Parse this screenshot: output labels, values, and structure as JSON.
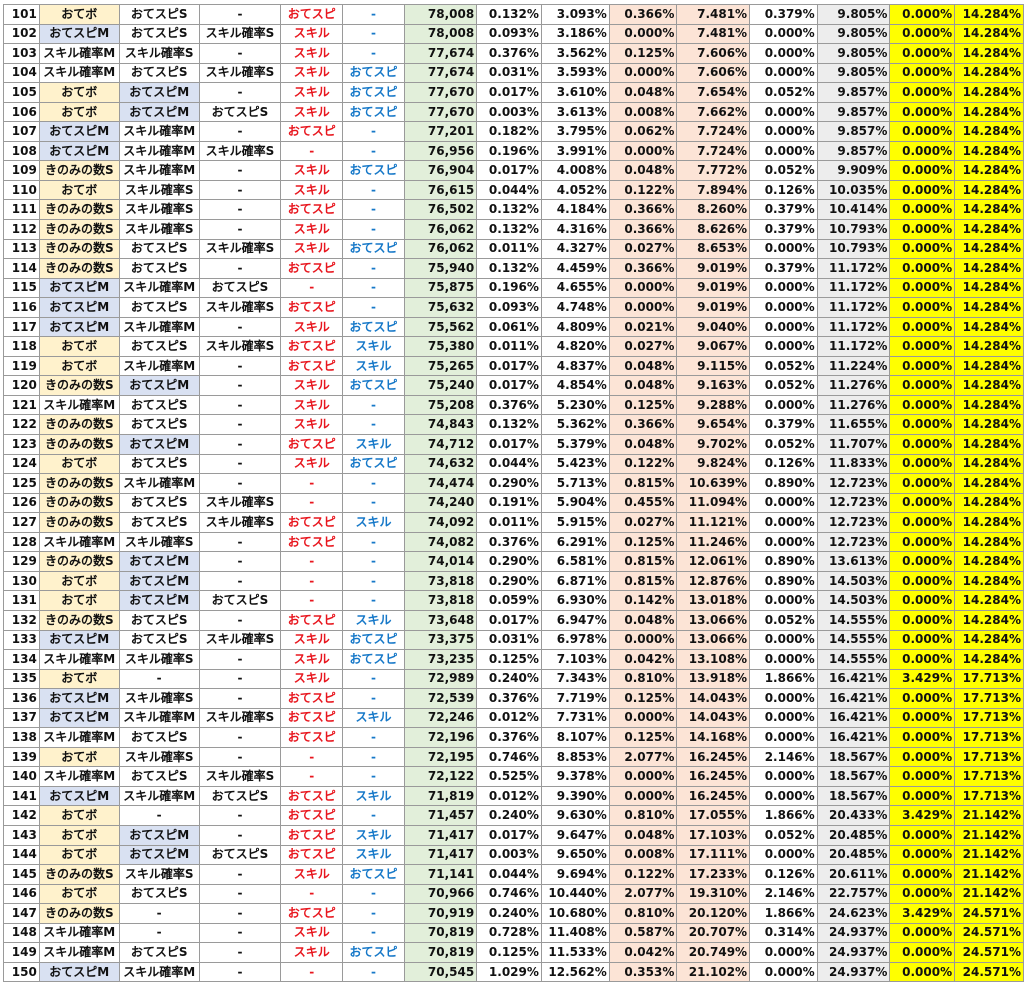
{
  "rows": [
    [
      "101",
      "おてボ",
      "おてスピS",
      "-",
      "おてスピ",
      "-",
      "78,008",
      "0.132%",
      "3.093%",
      "0.366%",
      "7.481%",
      "0.379%",
      "9.805%",
      "0.000%",
      "14.284%"
    ],
    [
      "102",
      "おてスピM",
      "おてスピS",
      "スキル確率S",
      "スキル",
      "-",
      "78,008",
      "0.093%",
      "3.186%",
      "0.000%",
      "7.481%",
      "0.000%",
      "9.805%",
      "0.000%",
      "14.284%"
    ],
    [
      "103",
      "スキル確率M",
      "スキル確率S",
      "-",
      "スキル",
      "-",
      "77,674",
      "0.376%",
      "3.562%",
      "0.125%",
      "7.606%",
      "0.000%",
      "9.805%",
      "0.000%",
      "14.284%"
    ],
    [
      "104",
      "スキル確率M",
      "おてスピS",
      "スキル確率S",
      "スキル",
      "おてスピ",
      "77,674",
      "0.031%",
      "3.593%",
      "0.000%",
      "7.606%",
      "0.000%",
      "9.805%",
      "0.000%",
      "14.284%"
    ],
    [
      "105",
      "おてボ",
      "おてスピM",
      "-",
      "スキル",
      "おてスピ",
      "77,670",
      "0.017%",
      "3.610%",
      "0.048%",
      "7.654%",
      "0.052%",
      "9.857%",
      "0.000%",
      "14.284%"
    ],
    [
      "106",
      "おてボ",
      "おてスピM",
      "おてスピS",
      "スキル",
      "おてスピ",
      "77,670",
      "0.003%",
      "3.613%",
      "0.008%",
      "7.662%",
      "0.000%",
      "9.857%",
      "0.000%",
      "14.284%"
    ],
    [
      "107",
      "おてスピM",
      "スキル確率M",
      "-",
      "おてスピ",
      "-",
      "77,201",
      "0.182%",
      "3.795%",
      "0.062%",
      "7.724%",
      "0.000%",
      "9.857%",
      "0.000%",
      "14.284%"
    ],
    [
      "108",
      "おてスピM",
      "スキル確率M",
      "スキル確率S",
      "-",
      "-",
      "76,956",
      "0.196%",
      "3.991%",
      "0.000%",
      "7.724%",
      "0.000%",
      "9.857%",
      "0.000%",
      "14.284%"
    ],
    [
      "109",
      "きのみの数S",
      "スキル確率M",
      "-",
      "スキル",
      "おてスピ",
      "76,904",
      "0.017%",
      "4.008%",
      "0.048%",
      "7.772%",
      "0.052%",
      "9.909%",
      "0.000%",
      "14.284%"
    ],
    [
      "110",
      "おてボ",
      "スキル確率S",
      "-",
      "スキル",
      "-",
      "76,615",
      "0.044%",
      "4.052%",
      "0.122%",
      "7.894%",
      "0.126%",
      "10.035%",
      "0.000%",
      "14.284%"
    ],
    [
      "111",
      "きのみの数S",
      "スキル確率S",
      "-",
      "おてスピ",
      "-",
      "76,502",
      "0.132%",
      "4.184%",
      "0.366%",
      "8.260%",
      "0.379%",
      "10.414%",
      "0.000%",
      "14.284%"
    ],
    [
      "112",
      "きのみの数S",
      "スキル確率S",
      "-",
      "スキル",
      "-",
      "76,062",
      "0.132%",
      "4.316%",
      "0.366%",
      "8.626%",
      "0.379%",
      "10.793%",
      "0.000%",
      "14.284%"
    ],
    [
      "113",
      "きのみの数S",
      "おてスピS",
      "スキル確率S",
      "スキル",
      "おてスピ",
      "76,062",
      "0.011%",
      "4.327%",
      "0.027%",
      "8.653%",
      "0.000%",
      "10.793%",
      "0.000%",
      "14.284%"
    ],
    [
      "114",
      "きのみの数S",
      "おてスピS",
      "-",
      "おてスピ",
      "-",
      "75,940",
      "0.132%",
      "4.459%",
      "0.366%",
      "9.019%",
      "0.379%",
      "11.172%",
      "0.000%",
      "14.284%"
    ],
    [
      "115",
      "おてスピM",
      "スキル確率M",
      "おてスピS",
      "-",
      "-",
      "75,875",
      "0.196%",
      "4.655%",
      "0.000%",
      "9.019%",
      "0.000%",
      "11.172%",
      "0.000%",
      "14.284%"
    ],
    [
      "116",
      "おてスピM",
      "おてスピS",
      "スキル確率S",
      "おてスピ",
      "-",
      "75,632",
      "0.093%",
      "4.748%",
      "0.000%",
      "9.019%",
      "0.000%",
      "11.172%",
      "0.000%",
      "14.284%"
    ],
    [
      "117",
      "おてスピM",
      "スキル確率M",
      "-",
      "スキル",
      "おてスピ",
      "75,562",
      "0.061%",
      "4.809%",
      "0.021%",
      "9.040%",
      "0.000%",
      "11.172%",
      "0.000%",
      "14.284%"
    ],
    [
      "118",
      "おてボ",
      "おてスピS",
      "スキル確率S",
      "おてスピ",
      "スキル",
      "75,380",
      "0.011%",
      "4.820%",
      "0.027%",
      "9.067%",
      "0.000%",
      "11.172%",
      "0.000%",
      "14.284%"
    ],
    [
      "119",
      "おてボ",
      "スキル確率M",
      "-",
      "おてスピ",
      "スキル",
      "75,265",
      "0.017%",
      "4.837%",
      "0.048%",
      "9.115%",
      "0.052%",
      "11.224%",
      "0.000%",
      "14.284%"
    ],
    [
      "120",
      "きのみの数S",
      "おてスピM",
      "-",
      "スキル",
      "おてスピ",
      "75,240",
      "0.017%",
      "4.854%",
      "0.048%",
      "9.163%",
      "0.052%",
      "11.276%",
      "0.000%",
      "14.284%"
    ],
    [
      "121",
      "スキル確率M",
      "おてスピS",
      "-",
      "スキル",
      "-",
      "75,208",
      "0.376%",
      "5.230%",
      "0.125%",
      "9.288%",
      "0.000%",
      "11.276%",
      "0.000%",
      "14.284%"
    ],
    [
      "122",
      "きのみの数S",
      "おてスピS",
      "-",
      "スキル",
      "-",
      "74,843",
      "0.132%",
      "5.362%",
      "0.366%",
      "9.654%",
      "0.379%",
      "11.655%",
      "0.000%",
      "14.284%"
    ],
    [
      "123",
      "きのみの数S",
      "おてスピM",
      "-",
      "おてスピ",
      "スキル",
      "74,712",
      "0.017%",
      "5.379%",
      "0.048%",
      "9.702%",
      "0.052%",
      "11.707%",
      "0.000%",
      "14.284%"
    ],
    [
      "124",
      "おてボ",
      "おてスピS",
      "-",
      "スキル",
      "おてスピ",
      "74,632",
      "0.044%",
      "5.423%",
      "0.122%",
      "9.824%",
      "0.126%",
      "11.833%",
      "0.000%",
      "14.284%"
    ],
    [
      "125",
      "きのみの数S",
      "スキル確率M",
      "-",
      "-",
      "-",
      "74,474",
      "0.290%",
      "5.713%",
      "0.815%",
      "10.639%",
      "0.890%",
      "12.723%",
      "0.000%",
      "14.284%"
    ],
    [
      "126",
      "きのみの数S",
      "おてスピS",
      "スキル確率S",
      "-",
      "-",
      "74,240",
      "0.191%",
      "5.904%",
      "0.455%",
      "11.094%",
      "0.000%",
      "12.723%",
      "0.000%",
      "14.284%"
    ],
    [
      "127",
      "きのみの数S",
      "おてスピS",
      "スキル確率S",
      "おてスピ",
      "スキル",
      "74,092",
      "0.011%",
      "5.915%",
      "0.027%",
      "11.121%",
      "0.000%",
      "12.723%",
      "0.000%",
      "14.284%"
    ],
    [
      "128",
      "スキル確率M",
      "スキル確率S",
      "-",
      "おてスピ",
      "-",
      "74,082",
      "0.376%",
      "6.291%",
      "0.125%",
      "11.246%",
      "0.000%",
      "12.723%",
      "0.000%",
      "14.284%"
    ],
    [
      "129",
      "きのみの数S",
      "おてスピM",
      "-",
      "-",
      "-",
      "74,014",
      "0.290%",
      "6.581%",
      "0.815%",
      "12.061%",
      "0.890%",
      "13.613%",
      "0.000%",
      "14.284%"
    ],
    [
      "130",
      "おてボ",
      "おてスピM",
      "-",
      "-",
      "-",
      "73,818",
      "0.290%",
      "6.871%",
      "0.815%",
      "12.876%",
      "0.890%",
      "14.503%",
      "0.000%",
      "14.284%"
    ],
    [
      "131",
      "おてボ",
      "おてスピM",
      "おてスピS",
      "-",
      "-",
      "73,818",
      "0.059%",
      "6.930%",
      "0.142%",
      "13.018%",
      "0.000%",
      "14.503%",
      "0.000%",
      "14.284%"
    ],
    [
      "132",
      "きのみの数S",
      "おてスピS",
      "-",
      "おてスピ",
      "スキル",
      "73,648",
      "0.017%",
      "6.947%",
      "0.048%",
      "13.066%",
      "0.052%",
      "14.555%",
      "0.000%",
      "14.284%"
    ],
    [
      "133",
      "おてスピM",
      "おてスピS",
      "スキル確率S",
      "スキル",
      "おてスピ",
      "73,375",
      "0.031%",
      "6.978%",
      "0.000%",
      "13.066%",
      "0.000%",
      "14.555%",
      "0.000%",
      "14.284%"
    ],
    [
      "134",
      "スキル確率M",
      "スキル確率S",
      "-",
      "スキル",
      "おてスピ",
      "73,235",
      "0.125%",
      "7.103%",
      "0.042%",
      "13.108%",
      "0.000%",
      "14.555%",
      "0.000%",
      "14.284%"
    ],
    [
      "135",
      "おてボ",
      "-",
      "-",
      "スキル",
      "-",
      "72,989",
      "0.240%",
      "7.343%",
      "0.810%",
      "13.918%",
      "1.866%",
      "16.421%",
      "3.429%",
      "17.713%"
    ],
    [
      "136",
      "おてスピM",
      "スキル確率S",
      "-",
      "おてスピ",
      "-",
      "72,539",
      "0.376%",
      "7.719%",
      "0.125%",
      "14.043%",
      "0.000%",
      "16.421%",
      "0.000%",
      "17.713%"
    ],
    [
      "137",
      "おてスピM",
      "スキル確率M",
      "スキル確率S",
      "おてスピ",
      "スキル",
      "72,246",
      "0.012%",
      "7.731%",
      "0.000%",
      "14.043%",
      "0.000%",
      "16.421%",
      "0.000%",
      "17.713%"
    ],
    [
      "138",
      "スキル確率M",
      "おてスピS",
      "-",
      "おてスピ",
      "-",
      "72,196",
      "0.376%",
      "8.107%",
      "0.125%",
      "14.168%",
      "0.000%",
      "16.421%",
      "0.000%",
      "17.713%"
    ],
    [
      "139",
      "おてボ",
      "スキル確率S",
      "-",
      "-",
      "-",
      "72,195",
      "0.746%",
      "8.853%",
      "2.077%",
      "16.245%",
      "2.146%",
      "18.567%",
      "0.000%",
      "17.713%"
    ],
    [
      "140",
      "スキル確率M",
      "おてスピS",
      "スキル確率S",
      "-",
      "-",
      "72,122",
      "0.525%",
      "9.378%",
      "0.000%",
      "16.245%",
      "0.000%",
      "18.567%",
      "0.000%",
      "17.713%"
    ],
    [
      "141",
      "おてスピM",
      "スキル確率M",
      "おてスピS",
      "おてスピ",
      "スキル",
      "71,819",
      "0.012%",
      "9.390%",
      "0.000%",
      "16.245%",
      "0.000%",
      "18.567%",
      "0.000%",
      "17.713%"
    ],
    [
      "142",
      "おてボ",
      "-",
      "-",
      "おてスピ",
      "-",
      "71,457",
      "0.240%",
      "9.630%",
      "0.810%",
      "17.055%",
      "1.866%",
      "20.433%",
      "3.429%",
      "21.142%"
    ],
    [
      "143",
      "おてボ",
      "おてスピM",
      "-",
      "おてスピ",
      "スキル",
      "71,417",
      "0.017%",
      "9.647%",
      "0.048%",
      "17.103%",
      "0.052%",
      "20.485%",
      "0.000%",
      "21.142%"
    ],
    [
      "144",
      "おてボ",
      "おてスピM",
      "おてスピS",
      "おてスピ",
      "スキル",
      "71,417",
      "0.003%",
      "9.650%",
      "0.008%",
      "17.111%",
      "0.000%",
      "20.485%",
      "0.000%",
      "21.142%"
    ],
    [
      "145",
      "きのみの数S",
      "スキル確率S",
      "-",
      "スキル",
      "おてスピ",
      "71,141",
      "0.044%",
      "9.694%",
      "0.122%",
      "17.233%",
      "0.126%",
      "20.611%",
      "0.000%",
      "21.142%"
    ],
    [
      "146",
      "おてボ",
      "おてスピS",
      "-",
      "-",
      "-",
      "70,966",
      "0.746%",
      "10.440%",
      "2.077%",
      "19.310%",
      "2.146%",
      "22.757%",
      "0.000%",
      "21.142%"
    ],
    [
      "147",
      "きのみの数S",
      "-",
      "-",
      "おてスピ",
      "-",
      "70,919",
      "0.240%",
      "10.680%",
      "0.810%",
      "20.120%",
      "1.866%",
      "24.623%",
      "3.429%",
      "24.571%"
    ],
    [
      "148",
      "スキル確率M",
      "-",
      "-",
      "スキル",
      "-",
      "70,819",
      "0.728%",
      "11.408%",
      "0.587%",
      "20.707%",
      "0.314%",
      "24.937%",
      "0.000%",
      "24.571%"
    ],
    [
      "149",
      "スキル確率M",
      "おてスピS",
      "-",
      "スキル",
      "おてスピ",
      "70,819",
      "0.125%",
      "11.533%",
      "0.042%",
      "20.749%",
      "0.000%",
      "24.937%",
      "0.000%",
      "24.571%"
    ],
    [
      "150",
      "おてスピM",
      "スキル確率M",
      "-",
      "-",
      "-",
      "70,545",
      "1.029%",
      "12.562%",
      "0.353%",
      "21.102%",
      "0.000%",
      "24.937%",
      "0.000%",
      "24.571%"
    ]
  ],
  "colors": {
    "cream": "#fff2cc",
    "blue": "#d9e1f2",
    "green": "#e2efda",
    "peach": "#fce4d6",
    "gray": "#ededed",
    "yellow": "#ffff00",
    "red_text": "#e8161e",
    "blue_text": "#1678c8"
  }
}
